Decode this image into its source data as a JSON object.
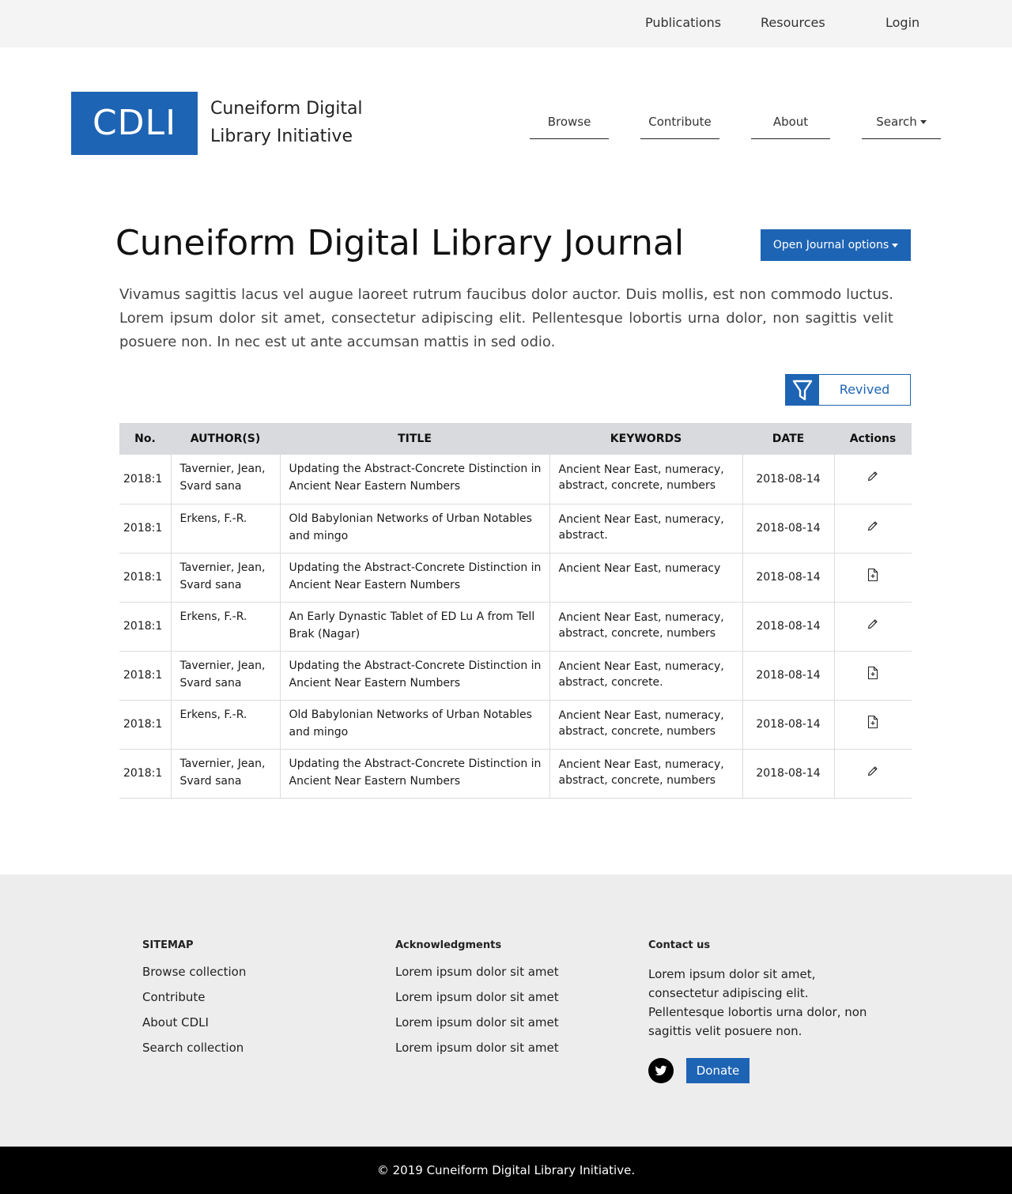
{
  "top_nav": {
    "publications": "Publications",
    "resources": "Resources",
    "login": "Login"
  },
  "logo": {
    "abbr": "CDLI",
    "line1": "Cuneiform Digital",
    "line2": "Library Initiative"
  },
  "main_nav": {
    "browse": "Browse",
    "contribute": "Contribute",
    "about": "About",
    "search": "Search"
  },
  "page": {
    "title": "Cuneiform Digital Library Journal",
    "options_button": "Open Journal options",
    "intro": "Vivamus sagittis lacus vel augue laoreet rutrum faucibus dolor auctor. Duis mollis, est non commodo luctus. Lorem ipsum dolor sit amet, consectetur adipiscing elit. Pellentesque lobortis urna dolor, non sagittis velit posuere non. In nec est ut ante accumsan mattis in sed odio.",
    "filter_label": "Revived"
  },
  "table": {
    "headers": {
      "no": "No.",
      "authors": "AUTHOR(S)",
      "title": "TITLE",
      "keywords": "KEYWORDS",
      "date": "DATE",
      "actions": "Actions"
    },
    "rows": [
      {
        "no": "2018:1",
        "authors": "Tavernier, Jean, Svard sana",
        "title": "Updating the Abstract-Concrete Distinction in Ancient Near Eastern Numbers",
        "title_link": true,
        "keywords": "Ancient Near East, numeracy, abstract, concrete, numbers",
        "date": "2018-08-14",
        "action_icon": "pencil-icon"
      },
      {
        "no": "2018:1",
        "authors": "Erkens, F.-R.",
        "title": "Old Babylonian Networks of Urban Notables and mingo",
        "title_link": true,
        "keywords": "Ancient Near East, numeracy, abstract.",
        "date": "2018-08-14",
        "action_icon": "pencil-icon"
      },
      {
        "no": "2018:1",
        "authors": "Tavernier, Jean, Svard sana",
        "title": "Updating the Abstract-Concrete Distinction in Ancient Near Eastern Numbers",
        "title_link": false,
        "keywords": "Ancient Near East, numeracy",
        "date": "2018-08-14",
        "action_icon": "file-add-icon"
      },
      {
        "no": "2018:1",
        "authors": "Erkens, F.-R.",
        "title": " An Early Dynastic Tablet of ED Lu A from Tell Brak (Nagar)",
        "title_link": true,
        "keywords": "Ancient Near East, numeracy, abstract, concrete, numbers",
        "date": "2018-08-14",
        "action_icon": "pencil-icon"
      },
      {
        "no": "2018:1",
        "authors": "Tavernier, Jean, Svard sana",
        "title": "Updating the Abstract-Concrete Distinction in Ancient Near Eastern Numbers",
        "title_link": false,
        "keywords": "Ancient Near East, numeracy, abstract, concrete.",
        "date": "2018-08-14",
        "action_icon": "file-add-icon"
      },
      {
        "no": "2018:1",
        "authors": "Erkens, F.-R.",
        "title": "Old Babylonian Networks of Urban Notables and mingo",
        "title_link": false,
        "keywords": "Ancient Near East, numeracy, abstract, concrete, numbers",
        "date": "2018-08-14",
        "action_icon": "file-add-icon"
      },
      {
        "no": "2018:1",
        "authors": "Tavernier, Jean, Svard sana",
        "title": "Updating the Abstract-Concrete Distinction in Ancient Near Eastern Numbers",
        "title_link": true,
        "keywords": "Ancient Near East, numeracy, abstract, concrete, numbers",
        "date": "2018-08-14",
        "action_icon": "pencil-icon"
      }
    ]
  },
  "footer": {
    "sitemap": {
      "heading": "SITEMAP",
      "links": [
        "Browse collection",
        "Contribute",
        "About CDLI",
        "Search collection"
      ]
    },
    "acknowledgments": {
      "heading": "Acknowledgments",
      "items": [
        "Lorem ipsum dolor sit amet",
        "Lorem ipsum dolor sit amet",
        "Lorem ipsum dolor sit amet",
        "Lorem ipsum dolor sit amet"
      ]
    },
    "contact": {
      "heading": "Contact us",
      "text": "Lorem ipsum dolor sit amet, consectetur adipiscing elit. Pellentesque lobortis urna dolor, non sagittis velit posuere non.",
      "social_icon": "twitter-icon",
      "donate_label": "Donate"
    },
    "copyright": "© 2019 Cuneiform Digital Library Initiative."
  },
  "colors": {
    "brand_blue": "#1e64b4",
    "table_header_bg": "#d9dadd",
    "footer_bg": "#ededed",
    "copyright_bg": "#000000"
  }
}
